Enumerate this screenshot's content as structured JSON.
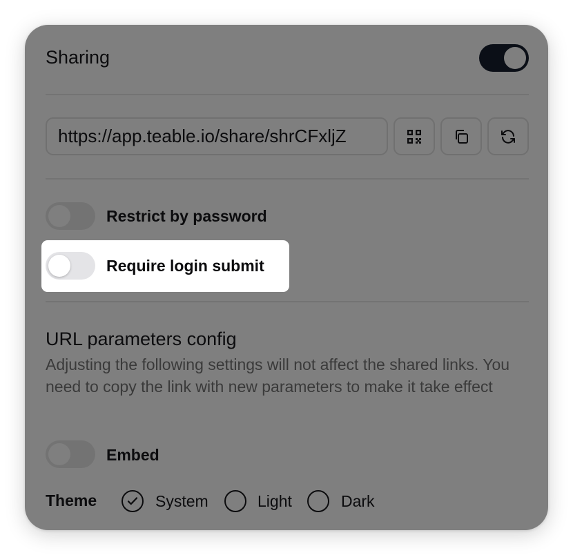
{
  "sharing": {
    "title": "Sharing",
    "enabled": true
  },
  "share_link": {
    "url": "https://app.teable.io/share/shrCFxljZ",
    "qr_button": "qr-code-icon",
    "copy_button": "copy-icon",
    "refresh_button": "refresh-icon"
  },
  "options": {
    "restrict_password": {
      "label": "Restrict by password",
      "enabled": false
    },
    "require_login": {
      "label": "Require login submit",
      "enabled": false
    }
  },
  "url_params": {
    "title": "URL parameters config",
    "description": "Adjusting the following settings will not affect the shared links. You need to copy the link with new parameters to make it take effect",
    "embed": {
      "label": "Embed",
      "enabled": false
    },
    "theme": {
      "label": "Theme",
      "options": [
        {
          "label": "System",
          "selected": true
        },
        {
          "label": "Light",
          "selected": false
        },
        {
          "label": "Dark",
          "selected": false
        }
      ]
    }
  },
  "colors": {
    "overlay": "#7f7f7f",
    "toggle_on": "#0b0f17",
    "highlight": "#ffffff"
  }
}
